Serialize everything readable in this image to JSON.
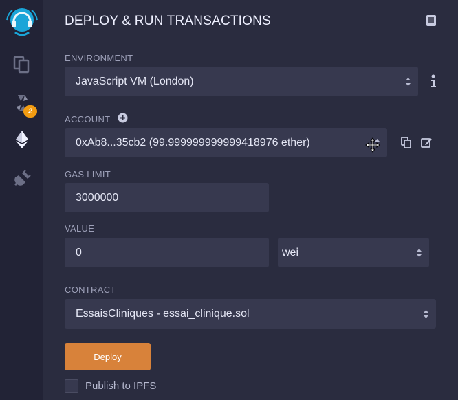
{
  "title": "DEPLOY & RUN TRANSACTIONS",
  "sidebar": {
    "badge_count": "2"
  },
  "environment": {
    "label": "ENVIRONMENT",
    "value": "JavaScript VM (London)"
  },
  "account": {
    "label": "ACCOUNT",
    "value": "0xAb8...35cb2 (99.999999999999418976 ether)"
  },
  "gas_limit": {
    "label": "GAS LIMIT",
    "value": "3000000"
  },
  "value": {
    "label": "VALUE",
    "amount": "0",
    "unit": "wei"
  },
  "contract": {
    "label": "CONTRACT",
    "value": "EssaisCliniques - essai_clinique.sol"
  },
  "deploy_label": "Deploy",
  "publish_label": "Publish to IPFS",
  "colors": {
    "accent": "#d8823a",
    "badge": "#f39c12",
    "background": "#2a2c3f",
    "field": "#37394f"
  }
}
